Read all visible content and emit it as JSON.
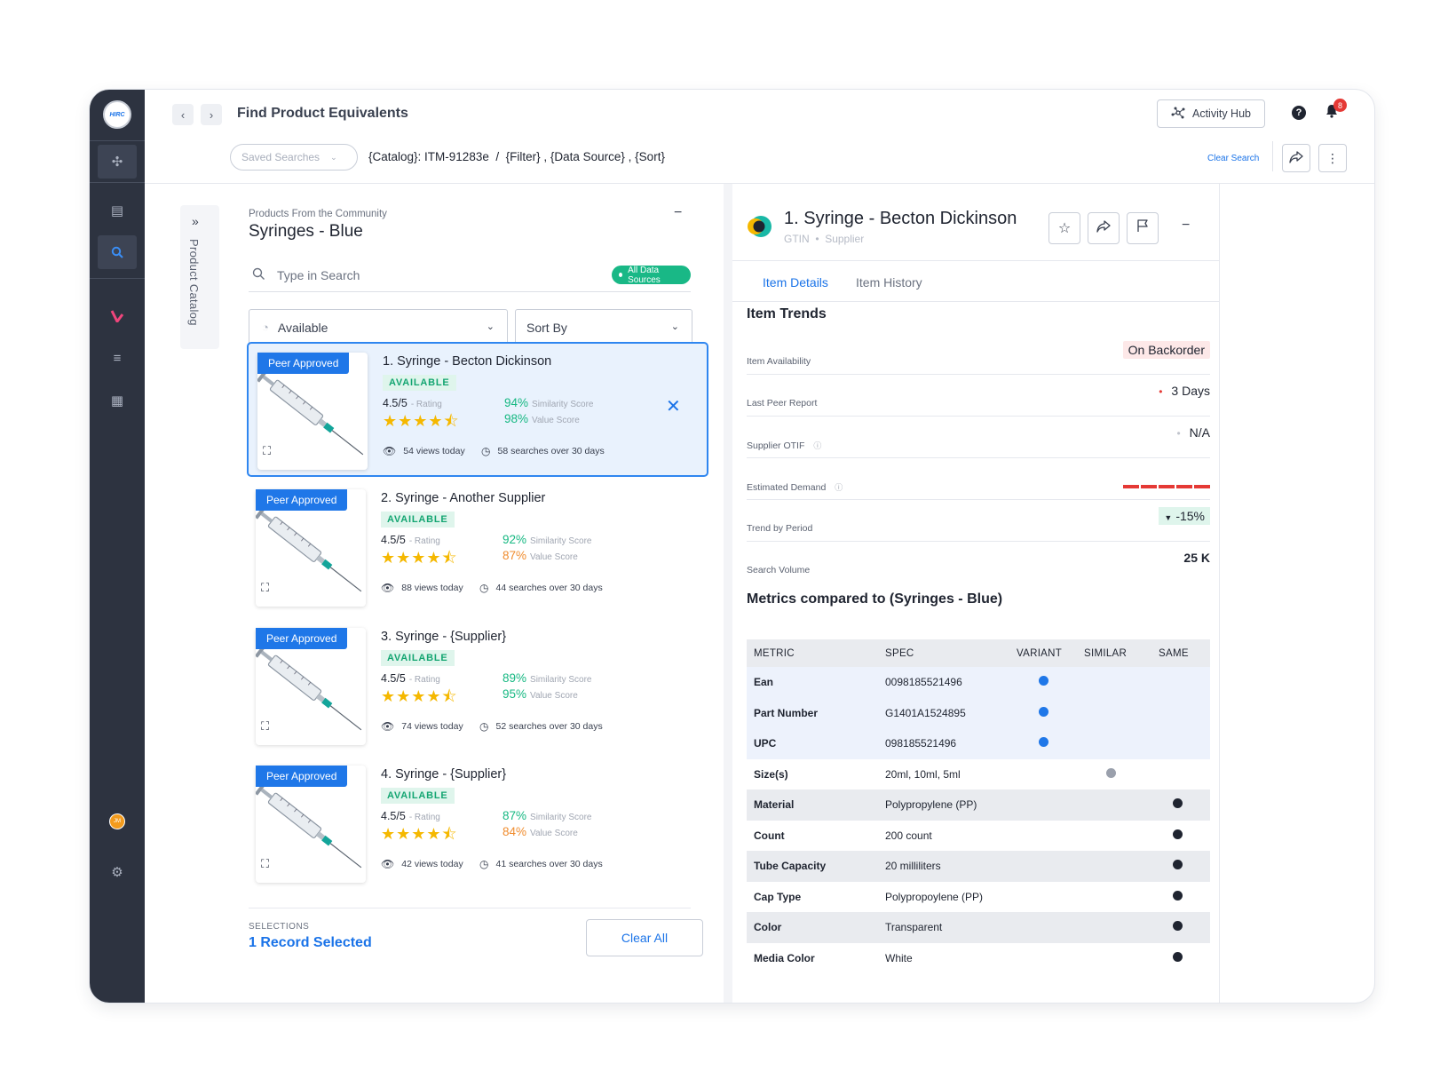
{
  "app": {
    "logo_text": "HIRC",
    "avatar_initials": "JM"
  },
  "header": {
    "title": "Find Product Equivalents",
    "activity_hub": "Activity Hub",
    "notification_count": "8",
    "saved_searches_placeholder": "Saved Searches",
    "breadcrumb": "{Catalog}: ITM-91283e  /  {Filter} , {Data Source} , {Sort}",
    "clear_search": "Clear Search"
  },
  "catalog_tab": {
    "label": "Product Catalog"
  },
  "left_panel": {
    "subtitle": "Products From the Community",
    "title": "Syringes - Blue",
    "search_placeholder": "Type in Search",
    "data_sources_pill": "All Data Sources",
    "filter_select": "Available",
    "sort_select": "Sort By",
    "products": [
      {
        "badge": "Peer Approved",
        "name": "1. Syringe - Becton Dickinson",
        "status": "AVAILABLE",
        "rating": "4.5/5",
        "rating_label": "- Rating",
        "similarity": "94%",
        "similarity_label": "Similarity Score",
        "value": "98%",
        "value_label": "Value Score",
        "value_color": "#16b882",
        "views": "54 views today",
        "searches": "58 searches over 30 days",
        "stars": 4.5
      },
      {
        "badge": "Peer Approved",
        "name": "2. Syringe - Another Supplier",
        "status": "AVAILABLE",
        "rating": "4.5/5",
        "rating_label": "- Rating",
        "similarity": "92%",
        "similarity_label": "Similarity Score",
        "value": "87%",
        "value_label": "Value Score",
        "value_color": "#f08c2e",
        "views": "88 views today",
        "searches": "44 searches over 30 days",
        "stars": 4.5
      },
      {
        "badge": "Peer Approved",
        "name": "3. Syringe - {Supplier}",
        "status": "AVAILABLE",
        "rating": "4.5/5",
        "rating_label": "- Rating",
        "similarity": "89%",
        "similarity_label": "Similarity Score",
        "value": "95%",
        "value_label": "Value Score",
        "value_color": "#16b882",
        "views": "74 views today",
        "searches": "52 searches over 30 days",
        "stars": 4.5
      },
      {
        "badge": "Peer Approved",
        "name": "4. Syringe - {Supplier}",
        "status": "AVAILABLE",
        "rating": "4.5/5",
        "rating_label": "- Rating",
        "similarity": "87%",
        "similarity_label": "Similarity Score",
        "value": "84%",
        "value_label": "Value Score",
        "value_color": "#f08c2e",
        "views": "42 views today",
        "searches": "41 searches over 30 days",
        "stars": 4.5
      }
    ],
    "selections_label": "SELECTIONS",
    "selections_value": "1 Record Selected",
    "clear_all": "Clear All"
  },
  "detail": {
    "title": "1. Syringe - Becton Dickinson",
    "subtitle": "GTIN  •  Supplier",
    "tabs": [
      "Item Details",
      "Item History"
    ],
    "trends_title": "Item Trends",
    "trends": {
      "availability_label": "Item Availability",
      "availability_value": "On Backorder",
      "peer_label": "Last Peer Report",
      "peer_value": "3 Days",
      "otif_label": "Supplier OTIF",
      "otif_value": "N/A",
      "demand_label": "Estimated Demand",
      "demand_level": 5,
      "trend_label": "Trend by Period",
      "trend_value": "-15%",
      "volume_label": "Search Volume",
      "volume_value": "25 K"
    },
    "metrics_title": "Metrics compared to (Syringes - Blue)",
    "metrics_headers": [
      "METRIC",
      "SPEC",
      "VARIANT",
      "SIMILAR",
      "SAME"
    ],
    "metrics": [
      {
        "metric": "Ean",
        "spec": "0098185521496",
        "match": "variant"
      },
      {
        "metric": "Part Number",
        "spec": "G1401A1524895",
        "match": "variant"
      },
      {
        "metric": "UPC",
        "spec": "098185521496",
        "match": "variant"
      },
      {
        "metric": "Size(s)",
        "spec": "20ml, 10ml, 5ml",
        "match": "similar"
      },
      {
        "metric": "Material",
        "spec": "Polypropylene (PP)",
        "match": "same"
      },
      {
        "metric": "Count",
        "spec": "200 count",
        "match": "same"
      },
      {
        "metric": "Tube Capacity",
        "spec": "20 milliliters",
        "match": "same"
      },
      {
        "metric": "Cap Type",
        "spec": "Polypropoylene (PP)",
        "match": "same"
      },
      {
        "metric": "Color",
        "spec": "Transparent",
        "match": "same"
      },
      {
        "metric": "Media Color",
        "spec": "White",
        "match": "same"
      }
    ]
  }
}
